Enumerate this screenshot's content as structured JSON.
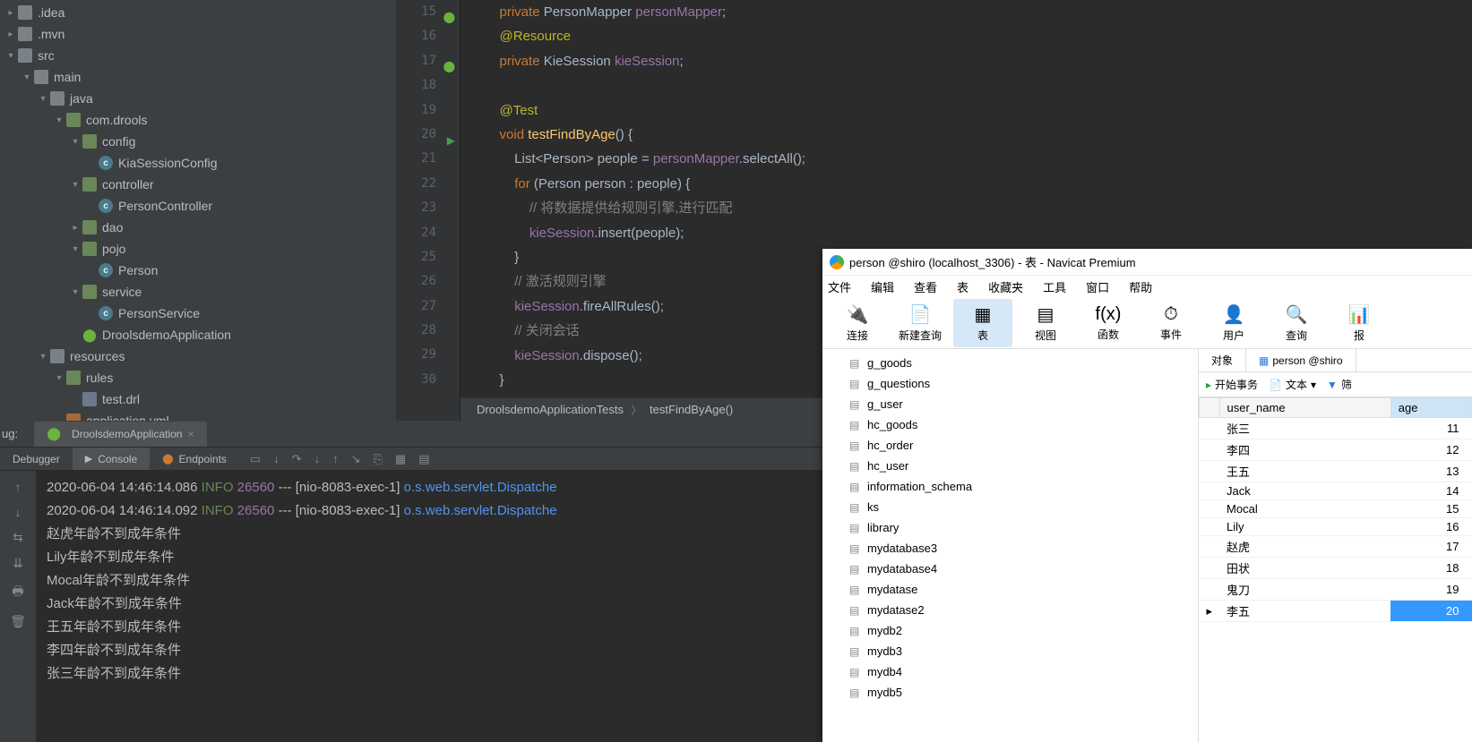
{
  "tree": [
    {
      "indent": 0,
      "arrow": "▸",
      "icon": "folder",
      "label": ".idea"
    },
    {
      "indent": 0,
      "arrow": "▸",
      "icon": "folder",
      "label": ".mvn"
    },
    {
      "indent": 0,
      "arrow": "▾",
      "icon": "folder",
      "label": "src"
    },
    {
      "indent": 1,
      "arrow": "▾",
      "icon": "folder",
      "label": "main"
    },
    {
      "indent": 2,
      "arrow": "▾",
      "icon": "folder",
      "label": "java"
    },
    {
      "indent": 3,
      "arrow": "▾",
      "icon": "pkg",
      "label": "com.drools"
    },
    {
      "indent": 4,
      "arrow": "▾",
      "icon": "pkg",
      "label": "config"
    },
    {
      "indent": 5,
      "arrow": "",
      "icon": "class",
      "label": "KiaSessionConfig"
    },
    {
      "indent": 4,
      "arrow": "▾",
      "icon": "pkg",
      "label": "controller"
    },
    {
      "indent": 5,
      "arrow": "",
      "icon": "class",
      "label": "PersonController"
    },
    {
      "indent": 4,
      "arrow": "▸",
      "icon": "pkg",
      "label": "dao"
    },
    {
      "indent": 4,
      "arrow": "▾",
      "icon": "pkg",
      "label": "pojo"
    },
    {
      "indent": 5,
      "arrow": "",
      "icon": "class",
      "label": "Person"
    },
    {
      "indent": 4,
      "arrow": "▾",
      "icon": "pkg",
      "label": "service"
    },
    {
      "indent": 5,
      "arrow": "",
      "icon": "class",
      "label": "PersonService"
    },
    {
      "indent": 4,
      "arrow": "",
      "icon": "spring",
      "label": "DroolsdemoApplication"
    },
    {
      "indent": 2,
      "arrow": "▾",
      "icon": "folder",
      "label": "resources"
    },
    {
      "indent": 3,
      "arrow": "▾",
      "icon": "pkg",
      "label": "rules"
    },
    {
      "indent": 4,
      "arrow": "",
      "icon": "file",
      "label": "test.drl"
    },
    {
      "indent": 3,
      "arrow": "",
      "icon": "yml",
      "label": "application.yml"
    }
  ],
  "code": {
    "lines": [
      {
        "n": 15,
        "gutter": "spring",
        "segs": [
          {
            "c": "",
            "t": "         "
          },
          {
            "c": "kw",
            "t": "private"
          },
          {
            "c": "",
            "t": " PersonMapper "
          },
          {
            "c": "field",
            "t": "personMapper"
          },
          {
            "c": "",
            "t": ";"
          }
        ]
      },
      {
        "n": 16,
        "segs": [
          {
            "c": "",
            "t": "         "
          },
          {
            "c": "ann",
            "t": "@Resource"
          }
        ]
      },
      {
        "n": 17,
        "gutter": "spring",
        "segs": [
          {
            "c": "",
            "t": "         "
          },
          {
            "c": "kw",
            "t": "private"
          },
          {
            "c": "",
            "t": " KieSession "
          },
          {
            "c": "field",
            "t": "kieSession"
          },
          {
            "c": "",
            "t": ";"
          }
        ]
      },
      {
        "n": 18,
        "segs": []
      },
      {
        "n": 19,
        "segs": [
          {
            "c": "",
            "t": "         "
          },
          {
            "c": "ann",
            "t": "@Test"
          }
        ]
      },
      {
        "n": 20,
        "gutter": "run",
        "segs": [
          {
            "c": "",
            "t": "         "
          },
          {
            "c": "kw",
            "t": "void"
          },
          {
            "c": "",
            "t": " "
          },
          {
            "c": "fn",
            "t": "testFindByAge"
          },
          {
            "c": "",
            "t": "() {"
          }
        ]
      },
      {
        "n": 21,
        "segs": [
          {
            "c": "",
            "t": "             List<Person> "
          },
          {
            "c": "id",
            "t": "people"
          },
          {
            "c": "",
            "t": " = "
          },
          {
            "c": "field",
            "t": "personMapper"
          },
          {
            "c": "",
            "t": ".selectAll();"
          }
        ]
      },
      {
        "n": 22,
        "segs": [
          {
            "c": "",
            "t": "             "
          },
          {
            "c": "kw",
            "t": "for"
          },
          {
            "c": "",
            "t": " (Person "
          },
          {
            "c": "id",
            "t": "person"
          },
          {
            "c": "",
            "t": " : people) {"
          }
        ]
      },
      {
        "n": 23,
        "segs": [
          {
            "c": "",
            "t": "                 "
          },
          {
            "c": "cmt",
            "t": "// 将数据提供给规则引擎,进行匹配"
          }
        ]
      },
      {
        "n": 24,
        "segs": [
          {
            "c": "",
            "t": "                 "
          },
          {
            "c": "field",
            "t": "kieSession"
          },
          {
            "c": "",
            "t": ".insert(people);"
          }
        ]
      },
      {
        "n": 25,
        "segs": [
          {
            "c": "",
            "t": "             }"
          }
        ]
      },
      {
        "n": 26,
        "segs": [
          {
            "c": "",
            "t": "             "
          },
          {
            "c": "cmt",
            "t": "// 激活规则引擎"
          }
        ]
      },
      {
        "n": 27,
        "segs": [
          {
            "c": "",
            "t": "             "
          },
          {
            "c": "field",
            "t": "kieSession"
          },
          {
            "c": "",
            "t": ".fireAllRules();"
          }
        ]
      },
      {
        "n": 28,
        "segs": [
          {
            "c": "",
            "t": "             "
          },
          {
            "c": "cmt",
            "t": "// 关闭会话"
          }
        ]
      },
      {
        "n": 29,
        "segs": [
          {
            "c": "",
            "t": "             "
          },
          {
            "c": "field",
            "t": "kieSession"
          },
          {
            "c": "",
            "t": ".dispose();"
          }
        ]
      },
      {
        "n": 30,
        "segs": [
          {
            "c": "",
            "t": "         }"
          }
        ]
      }
    ]
  },
  "breadcrumb": {
    "class": "DroolsdemoApplicationTests",
    "method": "testFindByAge()"
  },
  "debug_tab": {
    "label": "DroolsdemoApplication",
    "prefix": "ug:"
  },
  "inner_tabs": {
    "debugger": "Debugger",
    "console": "Console",
    "endpoints": "Endpoints"
  },
  "console_lines": [
    {
      "ts": "2020-06-04 14:46:14.086",
      "level": "INFO",
      "pid": "26560",
      "thread": "[nio-8083-exec-1]",
      "logger": "o.s.web.servlet.Dispatche"
    },
    {
      "ts": "2020-06-04 14:46:14.092",
      "level": "INFO",
      "pid": "26560",
      "thread": "[nio-8083-exec-1]",
      "logger": "o.s.web.servlet.Dispatche"
    }
  ],
  "console_msgs": [
    "赵虎年龄不到成年条件",
    "Lily年龄不到成年条件",
    "Mocal年龄不到成年条件",
    "Jack年龄不到成年条件",
    "王五年龄不到成年条件",
    "李四年龄不到成年条件",
    "张三年龄不到成年条件"
  ],
  "navicat": {
    "title": "person @shiro (localhost_3306) - 表 - Navicat Premium",
    "menu": [
      "文件",
      "编辑",
      "查看",
      "表",
      "收藏夹",
      "工具",
      "窗口",
      "帮助"
    ],
    "toolbar": [
      {
        "icon": "🔌",
        "label": "连接"
      },
      {
        "icon": "📄",
        "label": "新建查询"
      },
      {
        "icon": "▦",
        "label": "表",
        "active": true
      },
      {
        "icon": "▤",
        "label": "视图"
      },
      {
        "icon": "f(x)",
        "label": "函数"
      },
      {
        "icon": "⏱",
        "label": "事件"
      },
      {
        "icon": "👤",
        "label": "用户"
      },
      {
        "icon": "🔍",
        "label": "查询"
      },
      {
        "icon": "📊",
        "label": "报"
      }
    ],
    "tables": [
      "g_goods",
      "g_questions",
      "g_user",
      "hc_goods",
      "hc_order",
      "hc_user",
      "information_schema",
      "ks",
      "library",
      "mydatabase3",
      "mydatabase4",
      "mydatase",
      "mydatase2",
      "mydb2",
      "mydb3",
      "mydb4",
      "mydb5"
    ],
    "right_tabs": {
      "objects": "对象",
      "table": "person @shiro"
    },
    "right_tools": {
      "begin_tx": "开始事务",
      "text": "文本",
      "filter": "筛"
    },
    "grid_headers": {
      "name": "user_name",
      "age": "age"
    },
    "grid_rows": [
      {
        "name": "张三",
        "age": 11
      },
      {
        "name": "李四",
        "age": 12
      },
      {
        "name": "王五",
        "age": 13
      },
      {
        "name": "Jack",
        "age": 14
      },
      {
        "name": "Mocal",
        "age": 15
      },
      {
        "name": "Lily",
        "age": 16
      },
      {
        "name": "赵虎",
        "age": 17
      },
      {
        "name": "田状",
        "age": 18
      },
      {
        "name": "鬼刀",
        "age": 19
      },
      {
        "name": "李五",
        "age": 20,
        "selected": true
      }
    ]
  }
}
